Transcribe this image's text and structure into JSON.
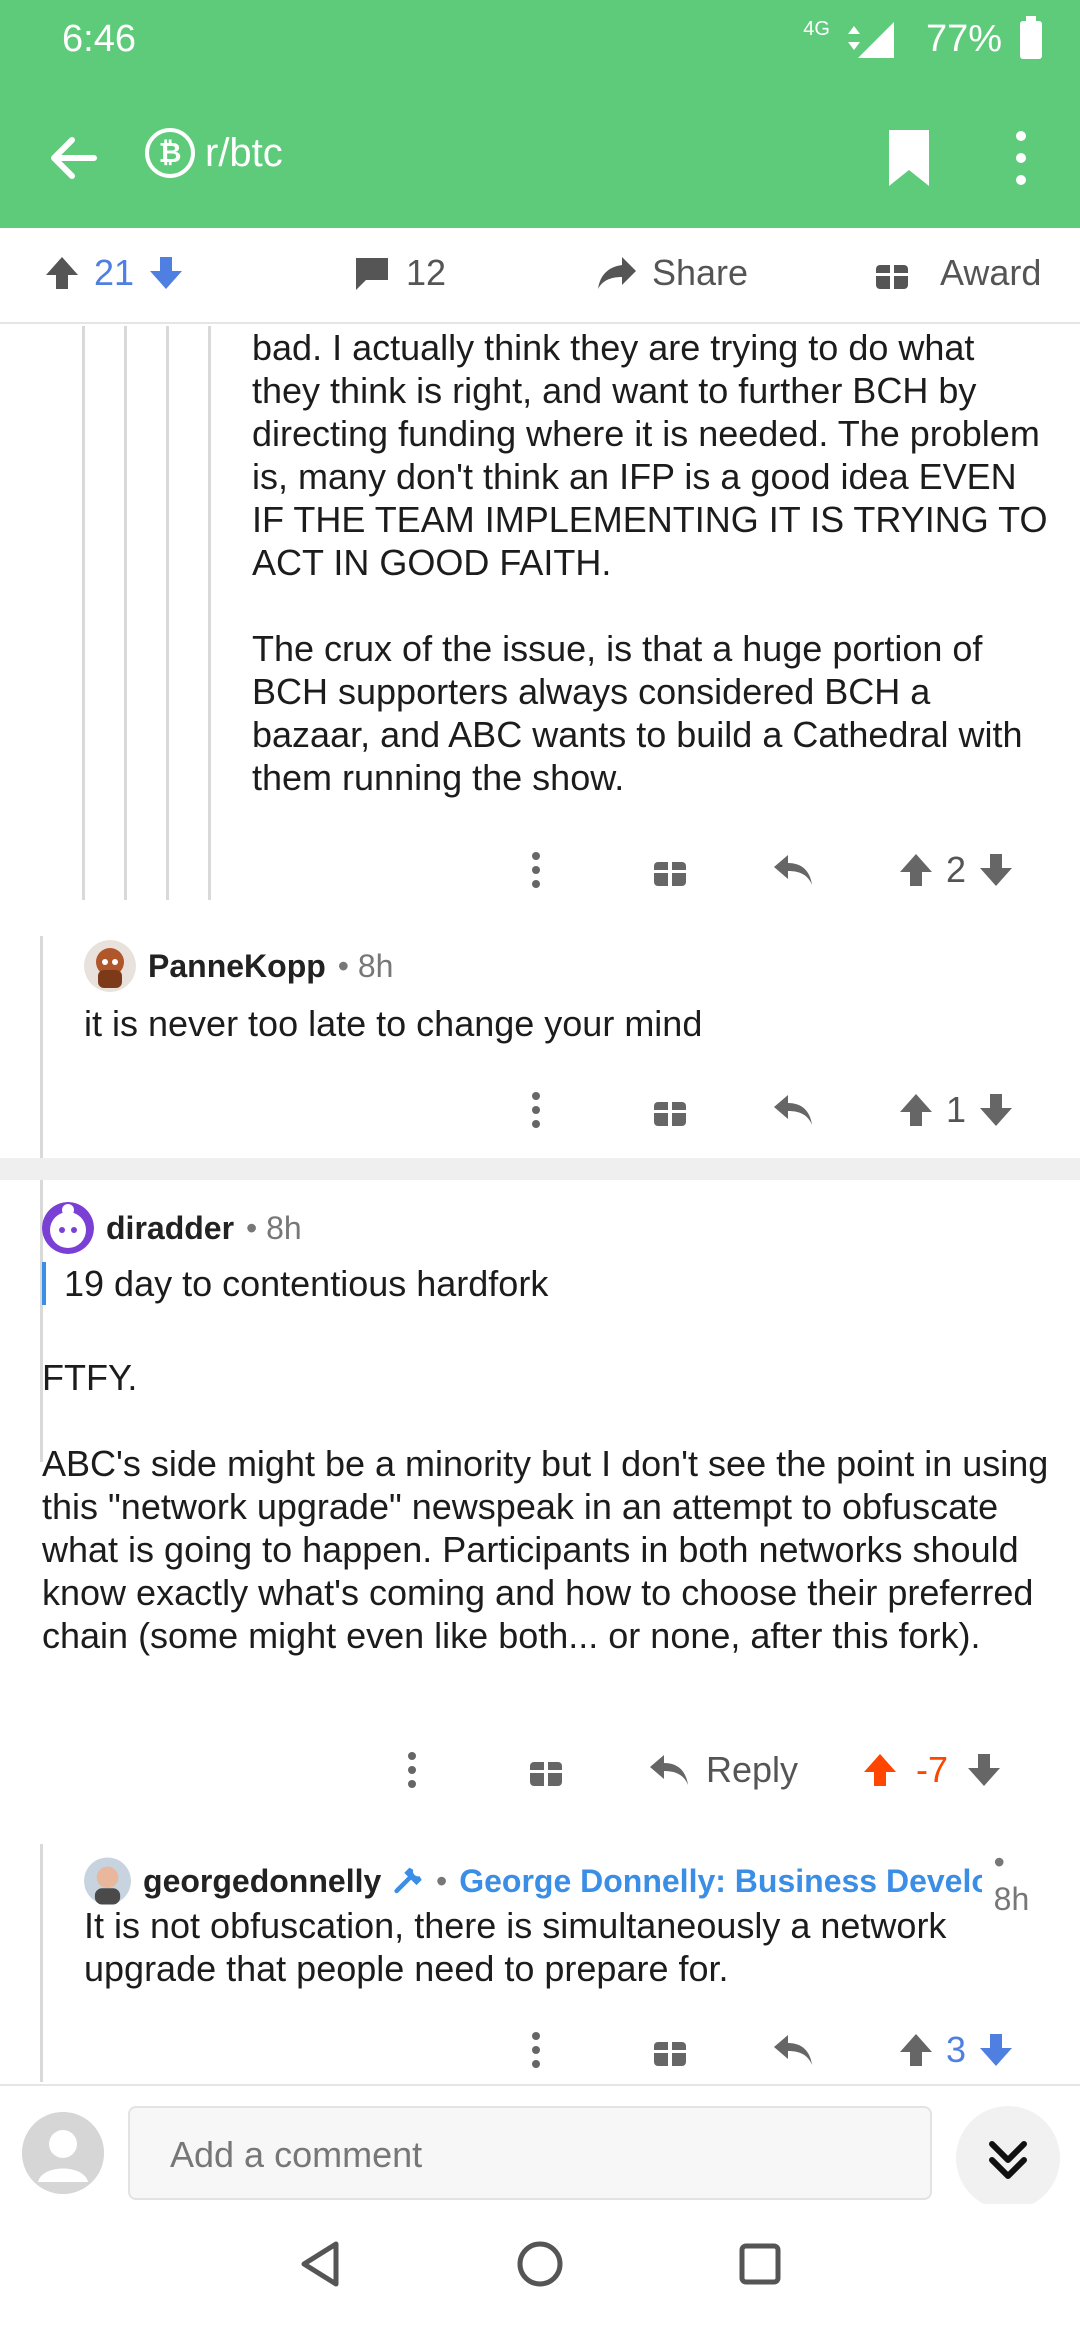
{
  "status_bar": {
    "time": "6:46",
    "network": "4G",
    "battery": "77%"
  },
  "app_bar": {
    "subreddit": "r/btc"
  },
  "action_bar": {
    "votes": "21",
    "comments": "12",
    "share_label": "Share",
    "award_label": "Award"
  },
  "comments": [
    {
      "paragraphs": [
        "bad. I actually think they are trying to do what they think is right, and want to further BCH by directing funding where it is needed. The problem is, many don't think an IFP is a good idea EVEN IF THE TEAM IMPLEMENTING IT IS TRYING TO ACT IN GOOD FAITH.",
        "The crux of the issue, is that a huge portion of BCH supporters always considered BCH a bazaar, and ABC wants to build a Cathedral with them running the show."
      ],
      "score": "2"
    },
    {
      "author": "PanneKopp",
      "age": "8h",
      "body": "it is never too late to change your mind",
      "score": "1"
    },
    {
      "author": "diradder",
      "age": "8h",
      "quote": "19 day to contentious hardfork",
      "paragraphs": [
        "FTFY.",
        "ABC's side might be a minority but I don't see the point in using this \"network upgrade\" newspeak in an attempt to obfuscate what is going to happen. Participants in both networks should know exactly what's coming and how to choose their preferred chain (some might even like both... or none, after this fork)."
      ],
      "reply_label": "Reply",
      "score": "-7"
    },
    {
      "author": "georgedonnelly",
      "flair": "George Donnelly: Business Develop...",
      "age": "8h",
      "body": "It is not obfuscation, there is simultaneously a network upgrade that people need to prepare for.",
      "score": "3"
    }
  ],
  "composer": {
    "placeholder": "Add a comment"
  },
  "colors": {
    "brand": "#5ecb7b",
    "upvote": "#4f7fe0",
    "downvote_active": "#ff4500",
    "flair": "#3a8ee6"
  }
}
